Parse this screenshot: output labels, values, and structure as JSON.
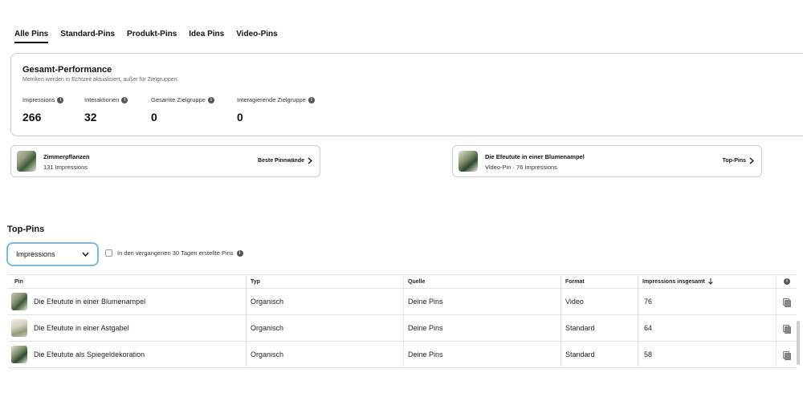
{
  "tabs": [
    {
      "label": "Alle Pins",
      "active": true
    },
    {
      "label": "Standard-Pins",
      "active": false
    },
    {
      "label": "Produkt-Pins",
      "active": false
    },
    {
      "label": "Idea Pins",
      "active": false
    },
    {
      "label": "Video-Pins",
      "active": false
    }
  ],
  "performance": {
    "title": "Gesamt-Performance",
    "subtitle": "Metriken werden in Echtzeit aktualisiert, außer für Zielgruppen.",
    "metrics": [
      {
        "label": "Impressions",
        "value": "266"
      },
      {
        "label": "Interaktionen",
        "value": "32"
      },
      {
        "label": "Gesamte Zielgruppe",
        "value": "0"
      },
      {
        "label": "Interagierende Zielgruppe",
        "value": "0"
      }
    ]
  },
  "highlights": [
    {
      "title": "Zimmerpflanzen",
      "subtitle": "131  Impressions",
      "link": "Beste Pinnwände"
    },
    {
      "title": "Die Efeutute in einer Blumenampel",
      "subtitle": "Video-Pin · 76  Impressions",
      "link": "Top-Pins"
    }
  ],
  "top_pins": {
    "title": "Top-Pins",
    "select_value": "Impressions",
    "checkbox_label": "In den vergangenen 30 Tagen erstellte Pins",
    "columns": {
      "pin": "Pin",
      "typ": "Typ",
      "quelle": "Quelle",
      "format": "Format",
      "impressions": "Impressions insgesamt"
    },
    "rows": [
      {
        "pin": "Die Efeutute in einer Blumenampel",
        "typ": "Organisch",
        "quelle": "Deine Pins",
        "format": "Video",
        "impressions": "76"
      },
      {
        "pin": "Die Efeutute in einer Astgabel",
        "typ": "Organisch",
        "quelle": "Deine Pins",
        "format": "Standard",
        "impressions": "64"
      },
      {
        "pin": "Die Efeutute als Spiegeldekoration",
        "typ": "Organisch",
        "quelle": "Deine Pins",
        "format": "Standard",
        "impressions": "58"
      }
    ]
  },
  "icons": {
    "info": "info-icon",
    "chevron_right": "chevron-right-icon",
    "chevron_down": "chevron-down-icon",
    "sort_down": "arrow-down-icon",
    "copy": "copy-icon"
  },
  "colors": {
    "select_border": "#7fb7e3",
    "text": "#111111",
    "border": "#cdcdcd"
  }
}
